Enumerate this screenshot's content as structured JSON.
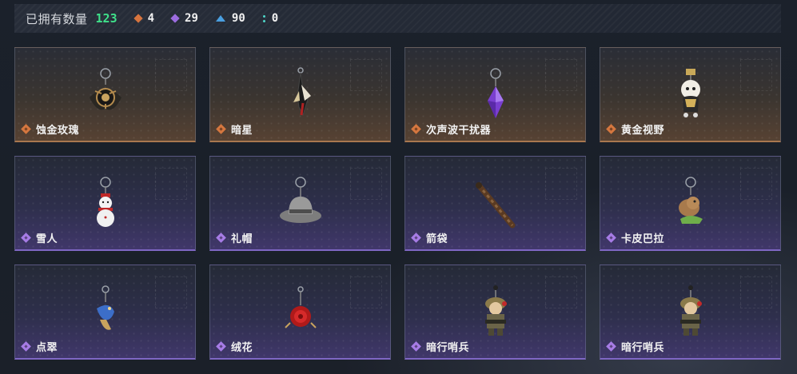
{
  "summary": {
    "owned_label": "已拥有数量",
    "owned_count": "123",
    "stats": [
      {
        "icon": "orange-diamond-icon",
        "color": "#d7743e",
        "value": "4"
      },
      {
        "icon": "purple-diamond-icon",
        "color": "#9c6ce0",
        "value": "29"
      },
      {
        "icon": "blue-triangle-icon",
        "color": "#4a9fe0",
        "value": "90"
      },
      {
        "icon": "teal-dots-icon",
        "color": "#4fd6c8",
        "value": "0"
      }
    ]
  },
  "items": [
    {
      "name": "蚀金玫瑰",
      "rarity": "orange",
      "icon": "gold-rose-charm-icon"
    },
    {
      "name": "暗星",
      "rarity": "orange",
      "icon": "dark-star-blade-charm-icon"
    },
    {
      "name": "次声波干扰器",
      "rarity": "orange",
      "icon": "purple-crystal-charm-icon"
    },
    {
      "name": "黄金视野",
      "rarity": "orange",
      "icon": "golden-figure-charm-icon"
    },
    {
      "name": "雪人",
      "rarity": "purple",
      "icon": "snowman-charm-icon"
    },
    {
      "name": "礼帽",
      "rarity": "purple",
      "icon": "hat-charm-icon"
    },
    {
      "name": "箭袋",
      "rarity": "purple",
      "icon": "quiver-charm-icon"
    },
    {
      "name": "卡皮巴拉",
      "rarity": "purple",
      "icon": "capybara-charm-icon"
    },
    {
      "name": "点翠",
      "rarity": "purple",
      "icon": "kingfisher-charm-icon"
    },
    {
      "name": "绒花",
      "rarity": "purple",
      "icon": "velvet-flower-charm-icon"
    },
    {
      "name": "暗行哨兵",
      "rarity": "purple",
      "icon": "soldier-charm-icon"
    },
    {
      "name": "暗行哨兵",
      "rarity": "purple",
      "icon": "soldier-charm-icon"
    }
  ],
  "colors": {
    "orange": "#d5773f",
    "purple": "#a77ce6",
    "owned_count": "#3fe08a"
  }
}
